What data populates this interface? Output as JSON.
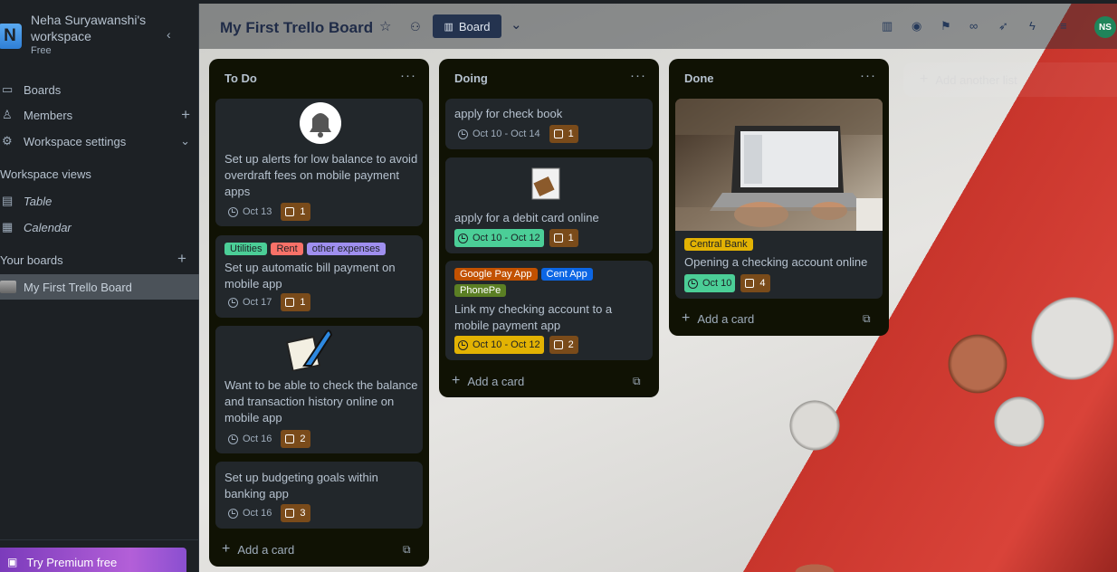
{
  "workspace": {
    "initial": "N",
    "name": "Neha Suryawanshi's workspace",
    "plan": "Free"
  },
  "sidebar": {
    "boards": "Boards",
    "members": "Members",
    "settings": "Workspace settings",
    "views_header": "Workspace views",
    "table": "Table",
    "calendar": "Calendar",
    "your_boards": "Your boards",
    "board_name": "My First Trello Board",
    "premium": "Try Premium free"
  },
  "header": {
    "title": "My First Trello Board",
    "view": "Board",
    "avatar": "NS"
  },
  "lists": [
    {
      "title": "To Do",
      "add": "Add a card",
      "cards": [
        {
          "text": "Set up alerts for low balance to avoid overdraft fees on mobile payment apps",
          "date": "Oct 13",
          "checklist": "1"
        },
        {
          "labels": [
            "Utilities",
            "Rent",
            "other expenses"
          ],
          "text": "Set up automatic bill payment on mobile app",
          "date": "Oct 17",
          "checklist": "1"
        },
        {
          "text": "Want to be able to check the balance and transaction history online on mobile app",
          "date": "Oct 16",
          "checklist": "2"
        },
        {
          "text": "Set up budgeting goals within banking app",
          "date": "Oct 16",
          "checklist": "3"
        }
      ]
    },
    {
      "title": "Doing",
      "add": "Add a card",
      "cards": [
        {
          "text": "apply for check book",
          "date": "Oct 10 - Oct 14",
          "checklist": "1"
        },
        {
          "text": "apply for a debit card online",
          "date": "Oct 10 - Oct 12",
          "checklist": "1"
        },
        {
          "labels": [
            "Google Pay App",
            "Cent App",
            "PhonePe"
          ],
          "text": "Link my checking account to a mobile payment app",
          "date": "Oct 10 - Oct 12",
          "checklist": "2"
        }
      ]
    },
    {
      "title": "Done",
      "add": "Add a card",
      "cards": [
        {
          "labels": [
            "Central Bank"
          ],
          "text": "Opening a checking account online",
          "date": "Oct 10",
          "checklist": "4"
        }
      ]
    }
  ],
  "add_list": "Add another list",
  "colors": {
    "green_date": "#4bce97",
    "yellow_date": "#e2b203",
    "label_green": "#4bce97",
    "label_red": "#f87168",
    "label_purple": "#9f8fef",
    "label_orange": "#c25100",
    "label_blue": "#0c66e4",
    "label_olive": "#5b7f24",
    "label_yellow": "#e2b203"
  }
}
